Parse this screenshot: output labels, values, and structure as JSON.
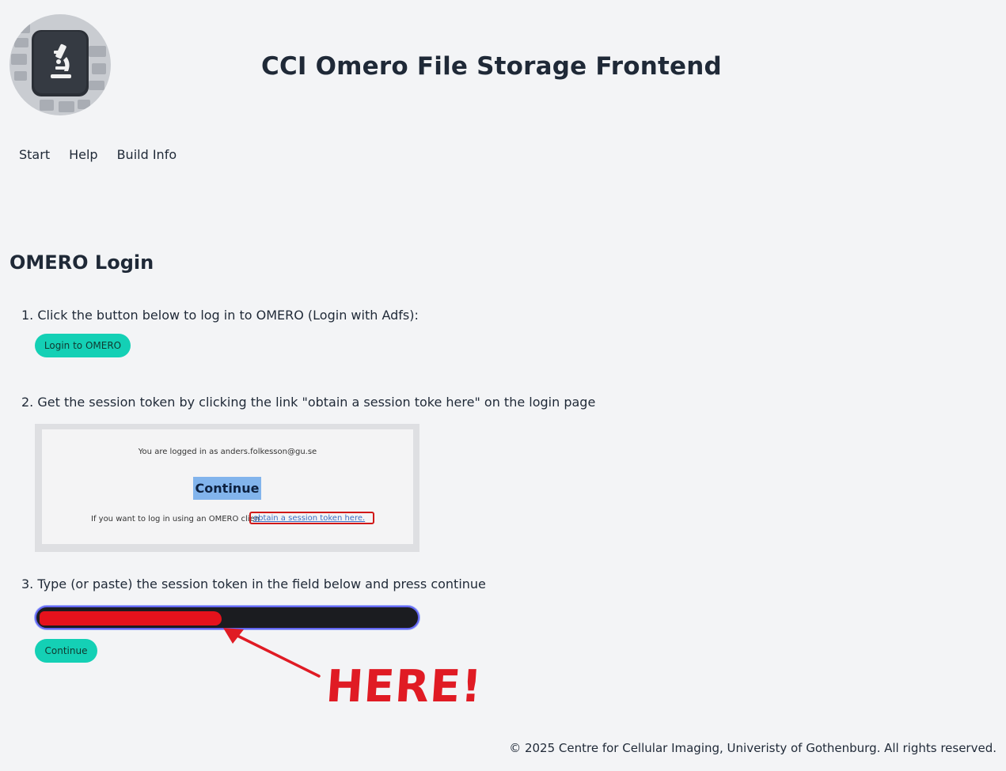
{
  "header": {
    "app_title": "CCI Omero File Storage Frontend",
    "logo_icon": "microscope-icon"
  },
  "nav": {
    "items": [
      {
        "label": "Start"
      },
      {
        "label": "Help"
      },
      {
        "label": "Build Info"
      }
    ]
  },
  "main": {
    "title": "OMERO Login",
    "step1": {
      "text": "1. Click the button below to log in to OMERO (Login with Adfs):",
      "button_label": "Login to OMERO"
    },
    "step2": {
      "text": "2. Get the session token by clicking the link \"obtain a session toke here\" on the login page",
      "screenshot": {
        "logged_in_text": "You are logged in as anders.folkesson@gu.se",
        "continue_label": "Continue",
        "client_text": "If you want to log in using an OMERO clien",
        "token_link_text": "obtain a session token here."
      }
    },
    "step3": {
      "text": "3. Type (or paste) the session token in the field below and press continue",
      "input_value": "",
      "button_label": "Continue"
    },
    "annotation": {
      "text": "HERE!"
    }
  },
  "footer": {
    "text": "© 2025 Centre for Cellular Imaging, Univeristy of Gothenburg. All rights reserved."
  },
  "colors": {
    "background": "#f3f4f6",
    "accent_button": "#14d0b5",
    "input_focus_border": "#6366f1",
    "annotation_red": "#e01b24"
  }
}
